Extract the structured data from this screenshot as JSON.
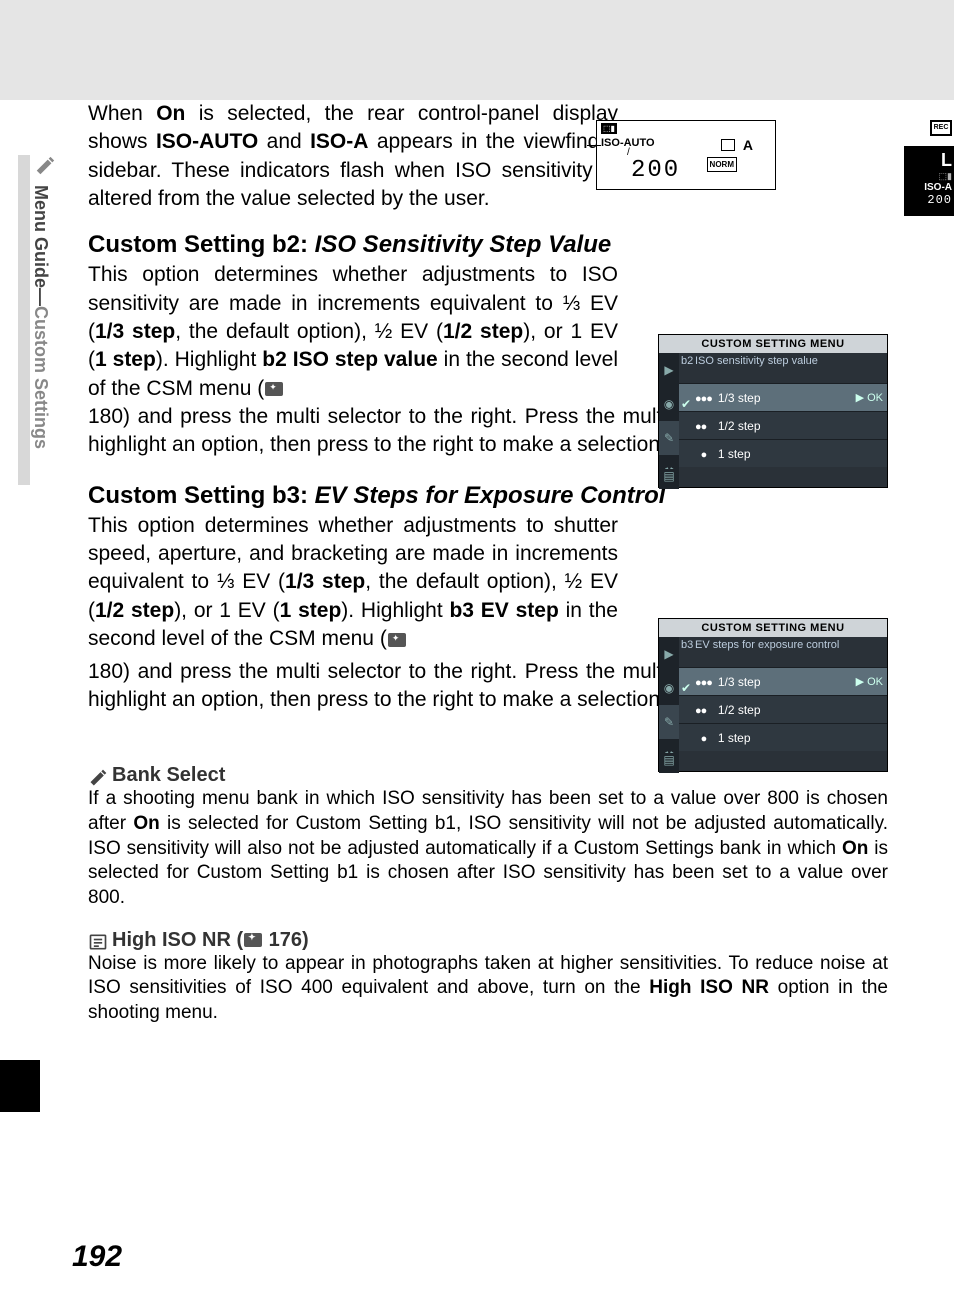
{
  "sidebar": {
    "label_part1": "Menu Guide—",
    "label_part2": "Custom Settings"
  },
  "lcd": {
    "iso_auto": "ISO-AUTO",
    "iso_value": "200",
    "norm": "NORM",
    "rec": "REC",
    "A": "A"
  },
  "viewfinder": {
    "L": "L",
    "iso_a": "ISO-A",
    "num": "200"
  },
  "para1": {
    "p1a": "When ",
    "p1b": "On",
    "p1c": " is selected, the rear control-panel display shows ",
    "p1d": "ISO-AUTO",
    "p1e": " and ",
    "p1f": "ISO-A",
    "p1g": " appears in the viewfinder sidebar.  These indicators flash when ISO sensitivity is altered from the value selected by the user."
  },
  "h_b2_a": "Custom Setting b2: ",
  "h_b2_b": "ISO Sensitivity Step Value",
  "para_b2": {
    "a": "This option determines whether adjustments to ISO sensitivity are made in increments equivalent to ⅓ EV (",
    "b": "1/3 step",
    "c": ", the default option), ½ EV (",
    "d": "1/2 step",
    "e": "), or 1 EV (",
    "f": "1 step",
    "g": ").  Highlight ",
    "h": "b2 ISO step value",
    "i": " in the second level of the CSM menu (",
    "j": " 180) and press the multi selector to the right.  Press the multi selector up or down to highlight an option, then press to the right to make a selection."
  },
  "h_b3_a": "Custom Setting b3: ",
  "h_b3_b": "EV Steps for Exposure Control",
  "para_b3": {
    "a": "This option determines whether adjustments to shutter speed, aperture, and bracketing are made in increments equivalent to ⅓ EV (",
    "b": "1/3 step",
    "c": ", the default option), ½ EV (",
    "d": "1/2 step",
    "e": "), or 1 EV (",
    "f": "1 step",
    "g": ").  Highlight ",
    "h": "b3 EV step",
    "i": " in the second level of the CSM menu (",
    "j": " 180) and press the multi selector to the right.  Press the multi selector up or down to highlight an option, then press to the right to make a selection."
  },
  "menu_b2": {
    "title": "CUSTOM SETTING MENU",
    "idx": "b2",
    "sub": "ISO sensitivity step value",
    "opts": [
      "1/3 step",
      "1/2 step",
      "1   step"
    ],
    "ok": "▶ OK"
  },
  "menu_b3": {
    "title": "CUSTOM SETTING MENU",
    "idx": "b3",
    "sub": "EV steps for exposure control",
    "opts": [
      "1/3 step",
      "1/2 step",
      "1   step"
    ],
    "ok": "▶ OK"
  },
  "note_bank": {
    "title": "Bank Select",
    "a": "If a shooting menu bank in which ISO sensitivity has been set to a value over 800 is chosen after ",
    "b": "On",
    "c": " is selected for Custom Setting b1, ISO sensitivity will not be adjusted automatically.  ISO sensitivity will also not be adjusted automatically if a Custom Settings bank in which ",
    "d": "On",
    "e": " is selected for Custom Setting b1 is chosen after ISO sensitivity has been set to a value over 800."
  },
  "note_nr": {
    "title_a": "High ISO NR (",
    "title_b": " 176)",
    "a": "Noise is more likely to appear in photographs taken at higher sensitivities.  To reduce noise at ISO sensitivities of ISO 400 equivalent and above, turn on the ",
    "b": "High ISO NR",
    "c": " option in the shooting menu."
  },
  "page_number": "192"
}
